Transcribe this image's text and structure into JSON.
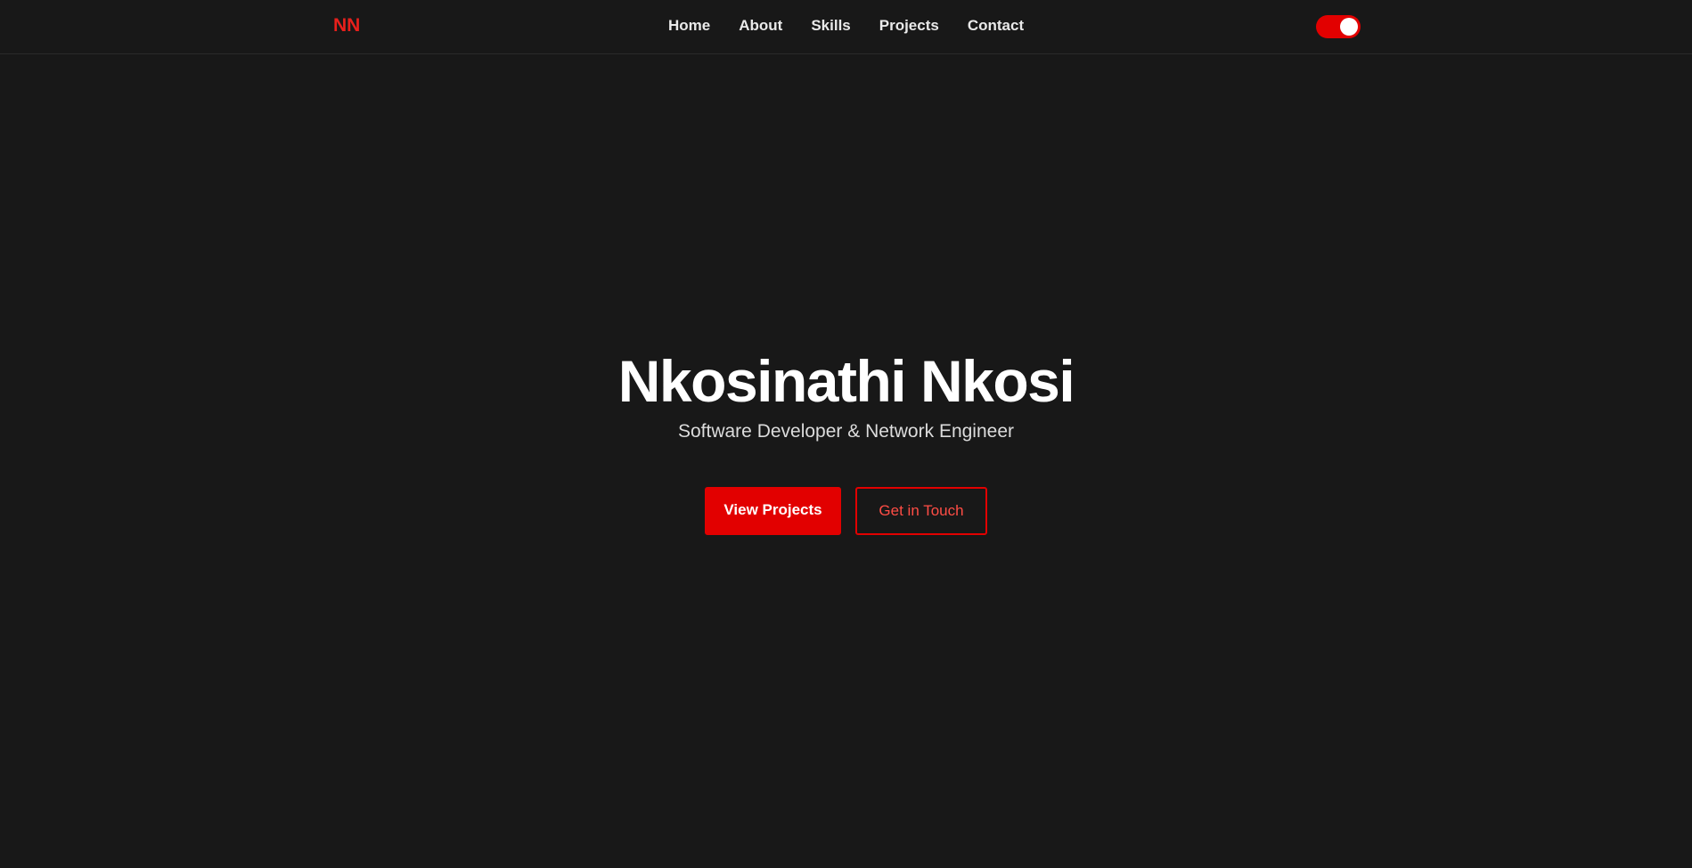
{
  "nav": {
    "logo": "NN",
    "links": [
      {
        "label": "Home"
      },
      {
        "label": "About"
      },
      {
        "label": "Skills"
      },
      {
        "label": "Projects"
      },
      {
        "label": "Contact"
      }
    ],
    "theme_toggle": {
      "state": "on",
      "color": "#e20000"
    }
  },
  "hero": {
    "title": "Nkosinathi Nkosi",
    "subtitle": "Software Developer & Network Engineer",
    "primary_button": "View Projects",
    "secondary_button": "Get in Touch"
  },
  "colors": {
    "background": "#181818",
    "accent": "#e20000",
    "accent_text": "#ff4d45"
  }
}
